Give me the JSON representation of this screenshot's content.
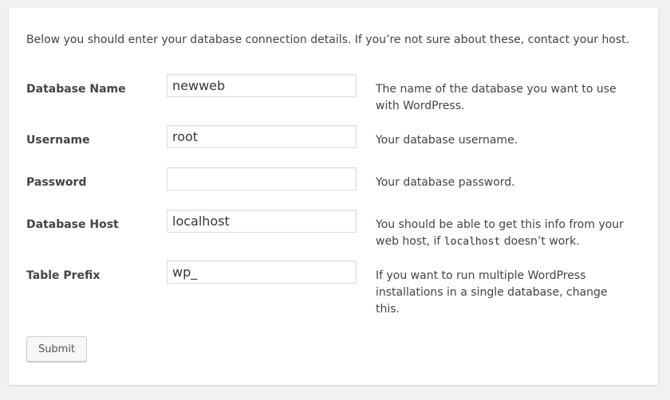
{
  "intro": "Below you should enter your database connection details. If you’re not sure about these, contact your host.",
  "fields": [
    {
      "label": "Database Name",
      "value": "newweb",
      "description": "The name of the database you want to use with WordPress."
    },
    {
      "label": "Username",
      "value": "root",
      "description": "Your database username."
    },
    {
      "label": "Password",
      "value": "",
      "description": "Your database password."
    },
    {
      "label": "Database Host",
      "value": "localhost",
      "description_pre": "You should be able to get this info from your web host, if ",
      "description_code": "localhost",
      "description_post": " doesn’t work."
    },
    {
      "label": "Table Prefix",
      "value": "wp_",
      "description": "If you want to run multiple WordPress installations in a single database, change this."
    }
  ],
  "submit_label": "Submit"
}
